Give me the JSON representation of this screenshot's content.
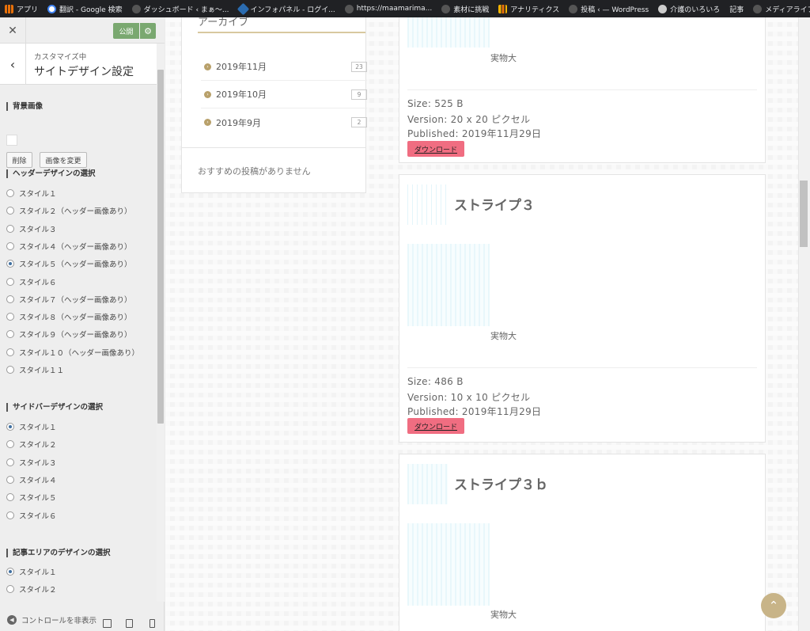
{
  "bookmarks": [
    {
      "label": "アプリ",
      "color": "#e8710a"
    },
    {
      "label": "翻訳 - Google 検索",
      "color": "#4285f4"
    },
    {
      "label": "ダッシュボード ‹ まぁ〜...",
      "color": "#888888"
    },
    {
      "label": "インフォパネル - ログイ...",
      "color": "#2b6cb0"
    },
    {
      "label": "https://maamarima...",
      "color": "#888888"
    },
    {
      "label": "素材に挑戦",
      "color": "#888888"
    },
    {
      "label": "アナリティクス",
      "color": "#f4b400"
    },
    {
      "label": "投稿 ‹ — WordPress",
      "color": "#888888"
    },
    {
      "label": "介護のいろいろ",
      "color": "#cccccc"
    },
    {
      "label": "記事",
      "color": "#888888"
    },
    {
      "label": "メディアライブラリ ‹ まぁ...",
      "color": "#888888"
    }
  ],
  "bookmarks_more": "»",
  "sidebar": {
    "close": "✕",
    "publish": "公開",
    "gear": "⚙",
    "back": "‹",
    "customizing": "カスタマイズ中",
    "section_title": "サイトデザイン設定",
    "bg_title": "背景画像",
    "remove_btn": "削除",
    "change_btn": "画像を変更",
    "header_title": "ヘッダーデザインの選択",
    "header_options": [
      "スタイル１",
      "スタイル２（ヘッダー画像あり）",
      "スタイル３",
      "スタイル４（ヘッダー画像あり）",
      "スタイル５（ヘッダー画像あり）",
      "スタイル６",
      "スタイル７（ヘッダー画像あり）",
      "スタイル８（ヘッダー画像あり）",
      "スタイル９（ヘッダー画像あり）",
      "スタイル１０（ヘッダー画像あり）",
      "スタイル１１"
    ],
    "header_selected": 4,
    "sidebar_title": "サイドバーデザインの選択",
    "sidebar_options": [
      "スタイル１",
      "スタイル２",
      "スタイル３",
      "スタイル４",
      "スタイル５",
      "スタイル６"
    ],
    "sidebar_selected": 0,
    "article_title": "記事エリアのデザインの選択",
    "article_options": [
      "スタイル１",
      "スタイル２"
    ],
    "article_selected": 0,
    "hide_controls": "コントロールを非表示"
  },
  "archive": {
    "heading": "アーカイブ",
    "items": [
      {
        "label": "2019年11月",
        "count": "23"
      },
      {
        "label": "2019年10月",
        "count": "9"
      },
      {
        "label": "2019年9月",
        "count": "2"
      }
    ]
  },
  "recommend": "おすすめの投稿がありません",
  "media": [
    {
      "title": "",
      "actual": "実物大",
      "size": "Size: 525 B",
      "version": "Version: 20 x 20 ピクセル",
      "published": "Published: 2019年11月29日",
      "download": "ダウンロード"
    },
    {
      "title": "ストライプ３",
      "actual": "実物大",
      "size": "Size: 486 B",
      "version": "Version: 10 x 10 ピクセル",
      "published": "Published: 2019年11月29日",
      "download": "ダウンロード"
    },
    {
      "title": "ストライプ３ｂ",
      "actual": "実物大"
    }
  ],
  "to_top": "⌃"
}
